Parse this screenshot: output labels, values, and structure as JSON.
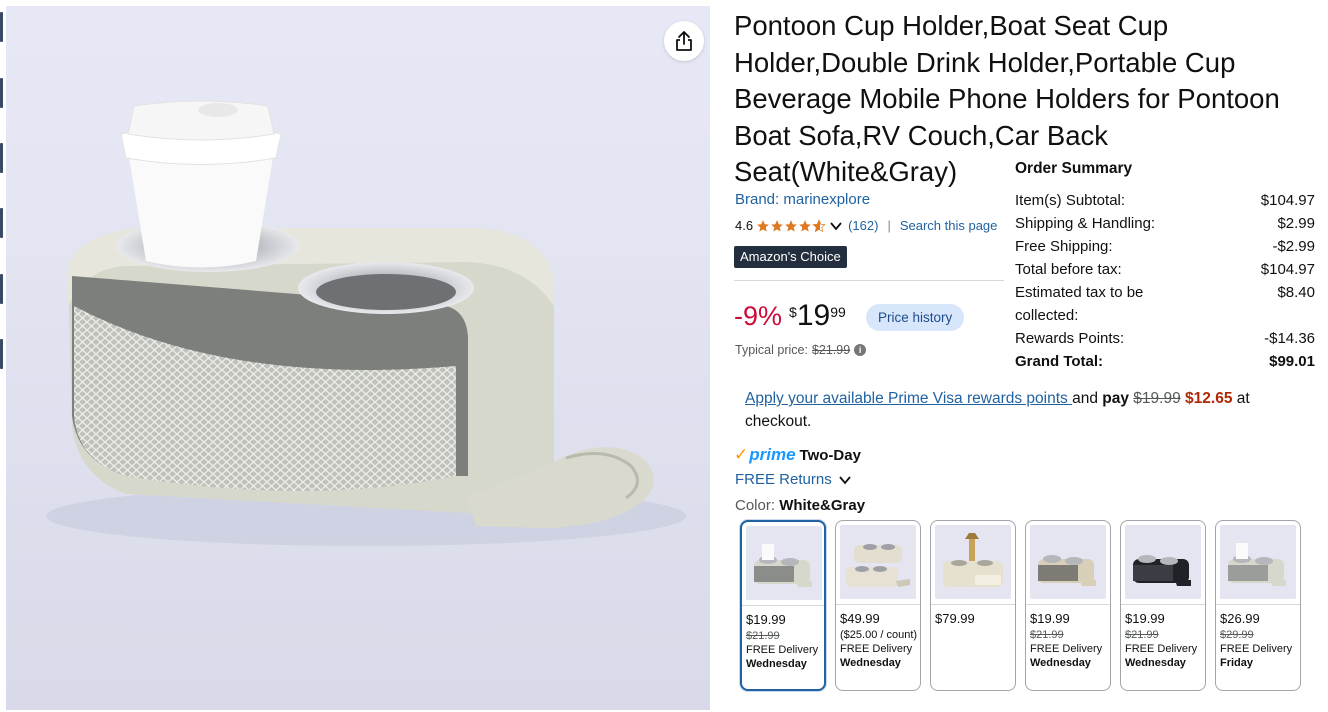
{
  "product": {
    "title": "Pontoon Cup Holder,Boat Seat Cup Holder,Double Drink Holder,Portable Cup Beverage Mobile Phone Holders for Pontoon Boat Sofa,RV Couch,Car Back Seat(White&Gray)",
    "brand_link": "Brand: marinexplore",
    "rating": "4.6",
    "rating_stars": 4.6,
    "ratings_count": "(162)",
    "search_page_link": "Search this page",
    "badge_amazon": "Amazon's",
    "badge_choice": "Choice",
    "share_icon": "share-icon"
  },
  "price": {
    "discount": "-9%",
    "currency": "$",
    "whole": "19",
    "fraction": "99",
    "price_history_button": "Price history",
    "typical_label": "Typical price:",
    "typical_value": "$21.99"
  },
  "order_summary": {
    "heading": "Order Summary",
    "rows": [
      {
        "label": "Item(s) Subtotal:",
        "value": "$104.97"
      },
      {
        "label": "Shipping & Handling:",
        "value": "$2.99"
      },
      {
        "label": "Free Shipping:",
        "value": "-$2.99"
      },
      {
        "label": "Total before tax:",
        "value": "$104.97"
      },
      {
        "label": "Estimated tax to be collected:",
        "value": "$8.40"
      },
      {
        "label": "Rewards Points:",
        "value": "-$14.36"
      },
      {
        "label": "Grand Total:",
        "value": "$99.01"
      }
    ]
  },
  "prime_visa": {
    "link": "Apply your available Prime Visa rewards points ",
    "and": "and ",
    "pay": "pay",
    "old_price": "$19.99",
    "new_price": "$12.65",
    "suffix": " at checkout."
  },
  "delivery": {
    "prime_word": "prime",
    "two_day": "Two-Day",
    "free_returns": "FREE Returns"
  },
  "color": {
    "label": "Color: ",
    "value": "White&Gray"
  },
  "swatches": [
    {
      "price": "$19.99",
      "typical": "$21.99",
      "per": "",
      "delivery": "FREE Delivery",
      "day": "Wednesday"
    },
    {
      "price": "$49.99",
      "typical": "",
      "per": "($25.00 / count)",
      "delivery": "FREE Delivery",
      "day": "Wednesday"
    },
    {
      "price": "$79.99",
      "typical": "",
      "per": "",
      "delivery": "",
      "day": ""
    },
    {
      "price": "$19.99",
      "typical": "$21.99",
      "per": "",
      "delivery": "FREE Delivery",
      "day": "Wednesday"
    },
    {
      "price": "$19.99",
      "typical": "$21.99",
      "per": "",
      "delivery": "FREE Delivery",
      "day": "Wednesday"
    },
    {
      "price": "$26.99",
      "typical": "$29.99",
      "per": "",
      "delivery": "FREE Delivery",
      "day": "Friday"
    }
  ],
  "colors": {
    "link": "#2162a1",
    "discount": "#cc0c39",
    "badge_bg": "#232f3e",
    "star": "#de7921",
    "prime_blue": "#1a98ff",
    "prime_check": "#ff9900",
    "price_history_bg": "#d7e6fb",
    "selected_border": "#2162a1"
  }
}
